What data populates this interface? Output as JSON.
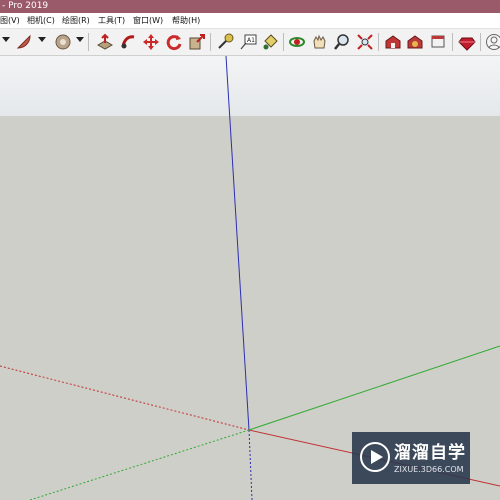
{
  "window": {
    "title": "- Pro 2019"
  },
  "menu": [
    "图(V)",
    "相机(C)",
    "绘图(R)",
    "工具(T)",
    "窗口(W)",
    "帮助(H)"
  ],
  "toolbar": {
    "tools": [
      "arc-tool-icon",
      "pie-tool-icon",
      "rotate-tool-icon",
      "push-pull-icon",
      "follow-me-icon",
      "move-icon",
      "rotate-icon",
      "scale-icon",
      "tape-measure-icon",
      "text-icon",
      "paint-bucket-icon",
      "orbit-icon",
      "pan-icon",
      "zoom-icon",
      "zoom-extents-icon",
      "warehouse-icon",
      "extension-warehouse-icon",
      "share-model-icon",
      "ruby-icon",
      "account-icon"
    ]
  },
  "watermark": {
    "name": "溜溜自学",
    "url": "ZIXUE.3D66.COM"
  },
  "colors": {
    "title_bar": "#9b5a6a",
    "sky": "#eef0f2",
    "ground": "#cfcfca",
    "axis_red": "#c03030",
    "axis_green": "#2faa2f",
    "axis_blue": "#2b2fb0"
  }
}
